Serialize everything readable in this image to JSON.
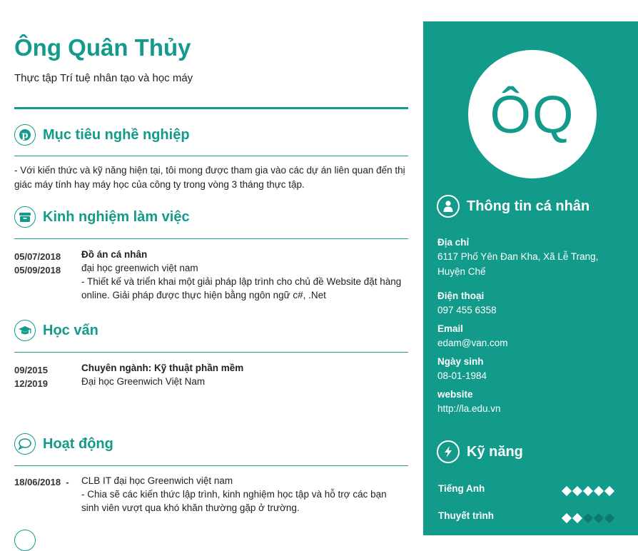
{
  "header": {
    "name": "Ông Quân Thủy",
    "subtitle": "Thực tập Trí tuệ nhân tạo và học máy"
  },
  "colors": {
    "accent": "#129a8b",
    "sidebar_bg": "#129a8b"
  },
  "objective": {
    "title": "Mục tiêu nghề nghiệp",
    "icon": "pinterest-icon",
    "text": "- Với kiến thức và kỹ năng hiện tại, tôi mong được tham gia vào các dự án liên quan đến thị giác máy tính hay máy học của công ty trong vòng 3 tháng thực tập."
  },
  "experience": {
    "title": "Kinh nghiệm làm việc",
    "icon": "archive-icon",
    "items": [
      {
        "date_from": "05/07/2018",
        "date_to": "05/09/2018",
        "title": "Đồ án cá nhân",
        "org": "đại học greenwich việt nam",
        "desc": "- Thiết kế và triển khai một giải pháp lập trình cho chủ đề Website đặt hàng online. Giải pháp được thực hiện bằng ngôn ngữ c#, .Net"
      }
    ]
  },
  "education": {
    "title": "Học vấn",
    "icon": "graduation-cap-icon",
    "items": [
      {
        "date_from": "09/2015",
        "date_to": "12/2019",
        "title": "Chuyên ngành: Kỹ thuật phần mềm",
        "org": "Đại học Greenwich Việt Nam"
      }
    ]
  },
  "activities": {
    "title": "Hoạt động",
    "icon": "speech-bubble-icon",
    "items": [
      {
        "date": "18/06/2018  -",
        "org": "CLB IT đại học Greenwich việt nam",
        "desc": "- Chia sẽ các kiến thức lập trình, kinh nghiệm học tập và hỗ trợ các bạn sinh viên vượt qua khó khăn thường gặp ở trường."
      }
    ]
  },
  "sidebar": {
    "avatar_initials": "ÔQ",
    "personal": {
      "title": "Thông tin cá nhân",
      "icon": "user-icon",
      "address_label": "Địa chỉ",
      "address": "6117 Phố Yên Đan Kha, Xã Lễ Trang, Huyện Chế",
      "phone_label": "Điện thoại",
      "phone": "097 455 6358",
      "email_label": "Email",
      "email": "edam@van.com",
      "dob_label": "Ngày sinh",
      "dob": "08-01-1984",
      "website_label": "website",
      "website": "http://la.edu.vn"
    },
    "skills": {
      "title": "Kỹ năng",
      "icon": "lightning-icon",
      "items": [
        {
          "name": "Tiếng Anh",
          "level": 5,
          "max": 5
        },
        {
          "name": "Thuyết trình",
          "level": 2,
          "max": 5
        }
      ]
    }
  }
}
